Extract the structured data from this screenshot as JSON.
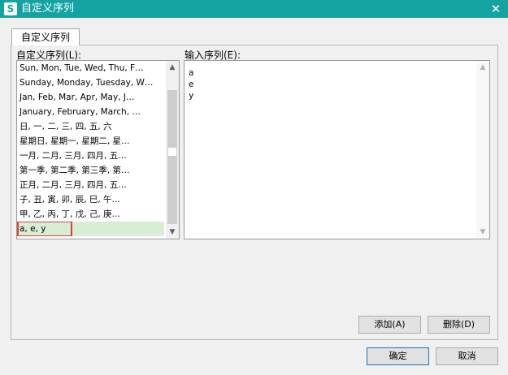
{
  "window": {
    "app_icon_glyph": "S",
    "title": "自定义序列",
    "close_glyph": "✕"
  },
  "tab": {
    "label": "自定义序列"
  },
  "list_label": "自定义序列(L):",
  "input_label": "输入序列(E):",
  "custom_lists": [
    "Sun, Mon, Tue, Wed, Thu, F…",
    "Sunday, Monday, Tuesday, W…",
    "Jan, Feb, Mar, Apr, May, J…",
    "January, February, March, …",
    "日, 一, 二, 三, 四, 五, 六",
    "星期日, 星期一, 星期二, 星…",
    "一月, 二月, 三月, 四月, 五…",
    "第一季, 第二季, 第三季, 第…",
    "正月, 二月, 三月, 四月, 五…",
    "子, 丑, 寅, 卯, 辰, 巳, 午…",
    "甲, 乙, 丙, 丁, 戊, 己, 庚…",
    "a, e, y"
  ],
  "selected_index": 11,
  "input_lines": [
    "a",
    "e",
    "y"
  ],
  "buttons": {
    "add": "添加(A)",
    "delete": "删除(D)",
    "ok": "确定",
    "cancel": "取消"
  },
  "colors": {
    "titlebar": "#13a3a0",
    "selection": "#d9ecd4",
    "highlight_outline": "#e23b3b"
  }
}
